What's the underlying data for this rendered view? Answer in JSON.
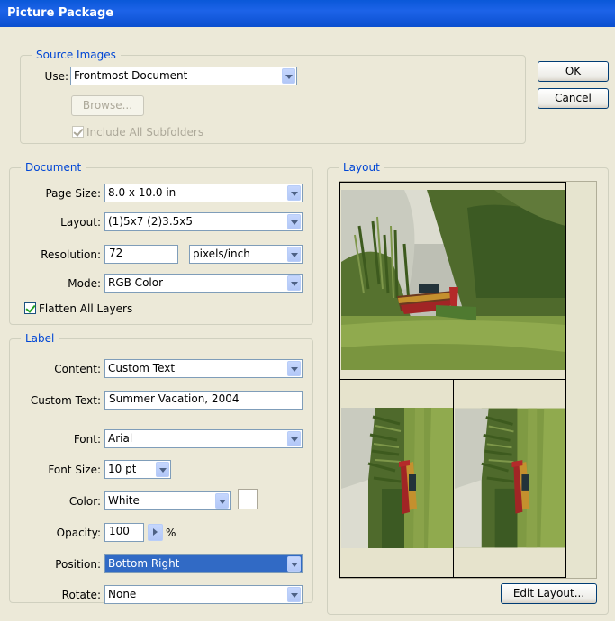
{
  "window": {
    "title": "Picture Package"
  },
  "buttons": {
    "ok": "OK",
    "cancel": "Cancel",
    "browse": "Browse...",
    "edit_layout": "Edit Layout..."
  },
  "source": {
    "legend": "Source Images",
    "use_label": "Use:",
    "use_value": "Frontmost Document",
    "include_subfolders": "Include All Subfolders",
    "include_subfolders_checked": true
  },
  "document": {
    "legend": "Document",
    "page_size_label": "Page Size:",
    "page_size": "8.0 x 10.0 in",
    "layout_label": "Layout:",
    "layout": "(1)5x7 (2)3.5x5",
    "resolution_label": "Resolution:",
    "resolution": "72",
    "resolution_unit": "pixels/inch",
    "mode_label": "Mode:",
    "mode": "RGB Color",
    "flatten": "Flatten All Layers",
    "flatten_checked": true
  },
  "label": {
    "legend": "Label",
    "content_label": "Content:",
    "content": "Custom Text",
    "custom_text_label": "Custom Text:",
    "custom_text": "Summer Vacation, 2004",
    "font_label": "Font:",
    "font": "Arial",
    "font_size_label": "Font Size:",
    "font_size": "10 pt",
    "color_label": "Color:",
    "color": "White",
    "color_swatch": "#ffffff",
    "opacity_label": "Opacity:",
    "opacity": "100",
    "opacity_unit": "%",
    "position_label": "Position:",
    "position": "Bottom Right",
    "rotate_label": "Rotate:",
    "rotate": "None"
  },
  "layout_panel": {
    "legend": "Layout"
  },
  "colors": {
    "title_bar": "#0a58d8",
    "legend_text": "#0046d5",
    "selection": "#316ac5"
  }
}
